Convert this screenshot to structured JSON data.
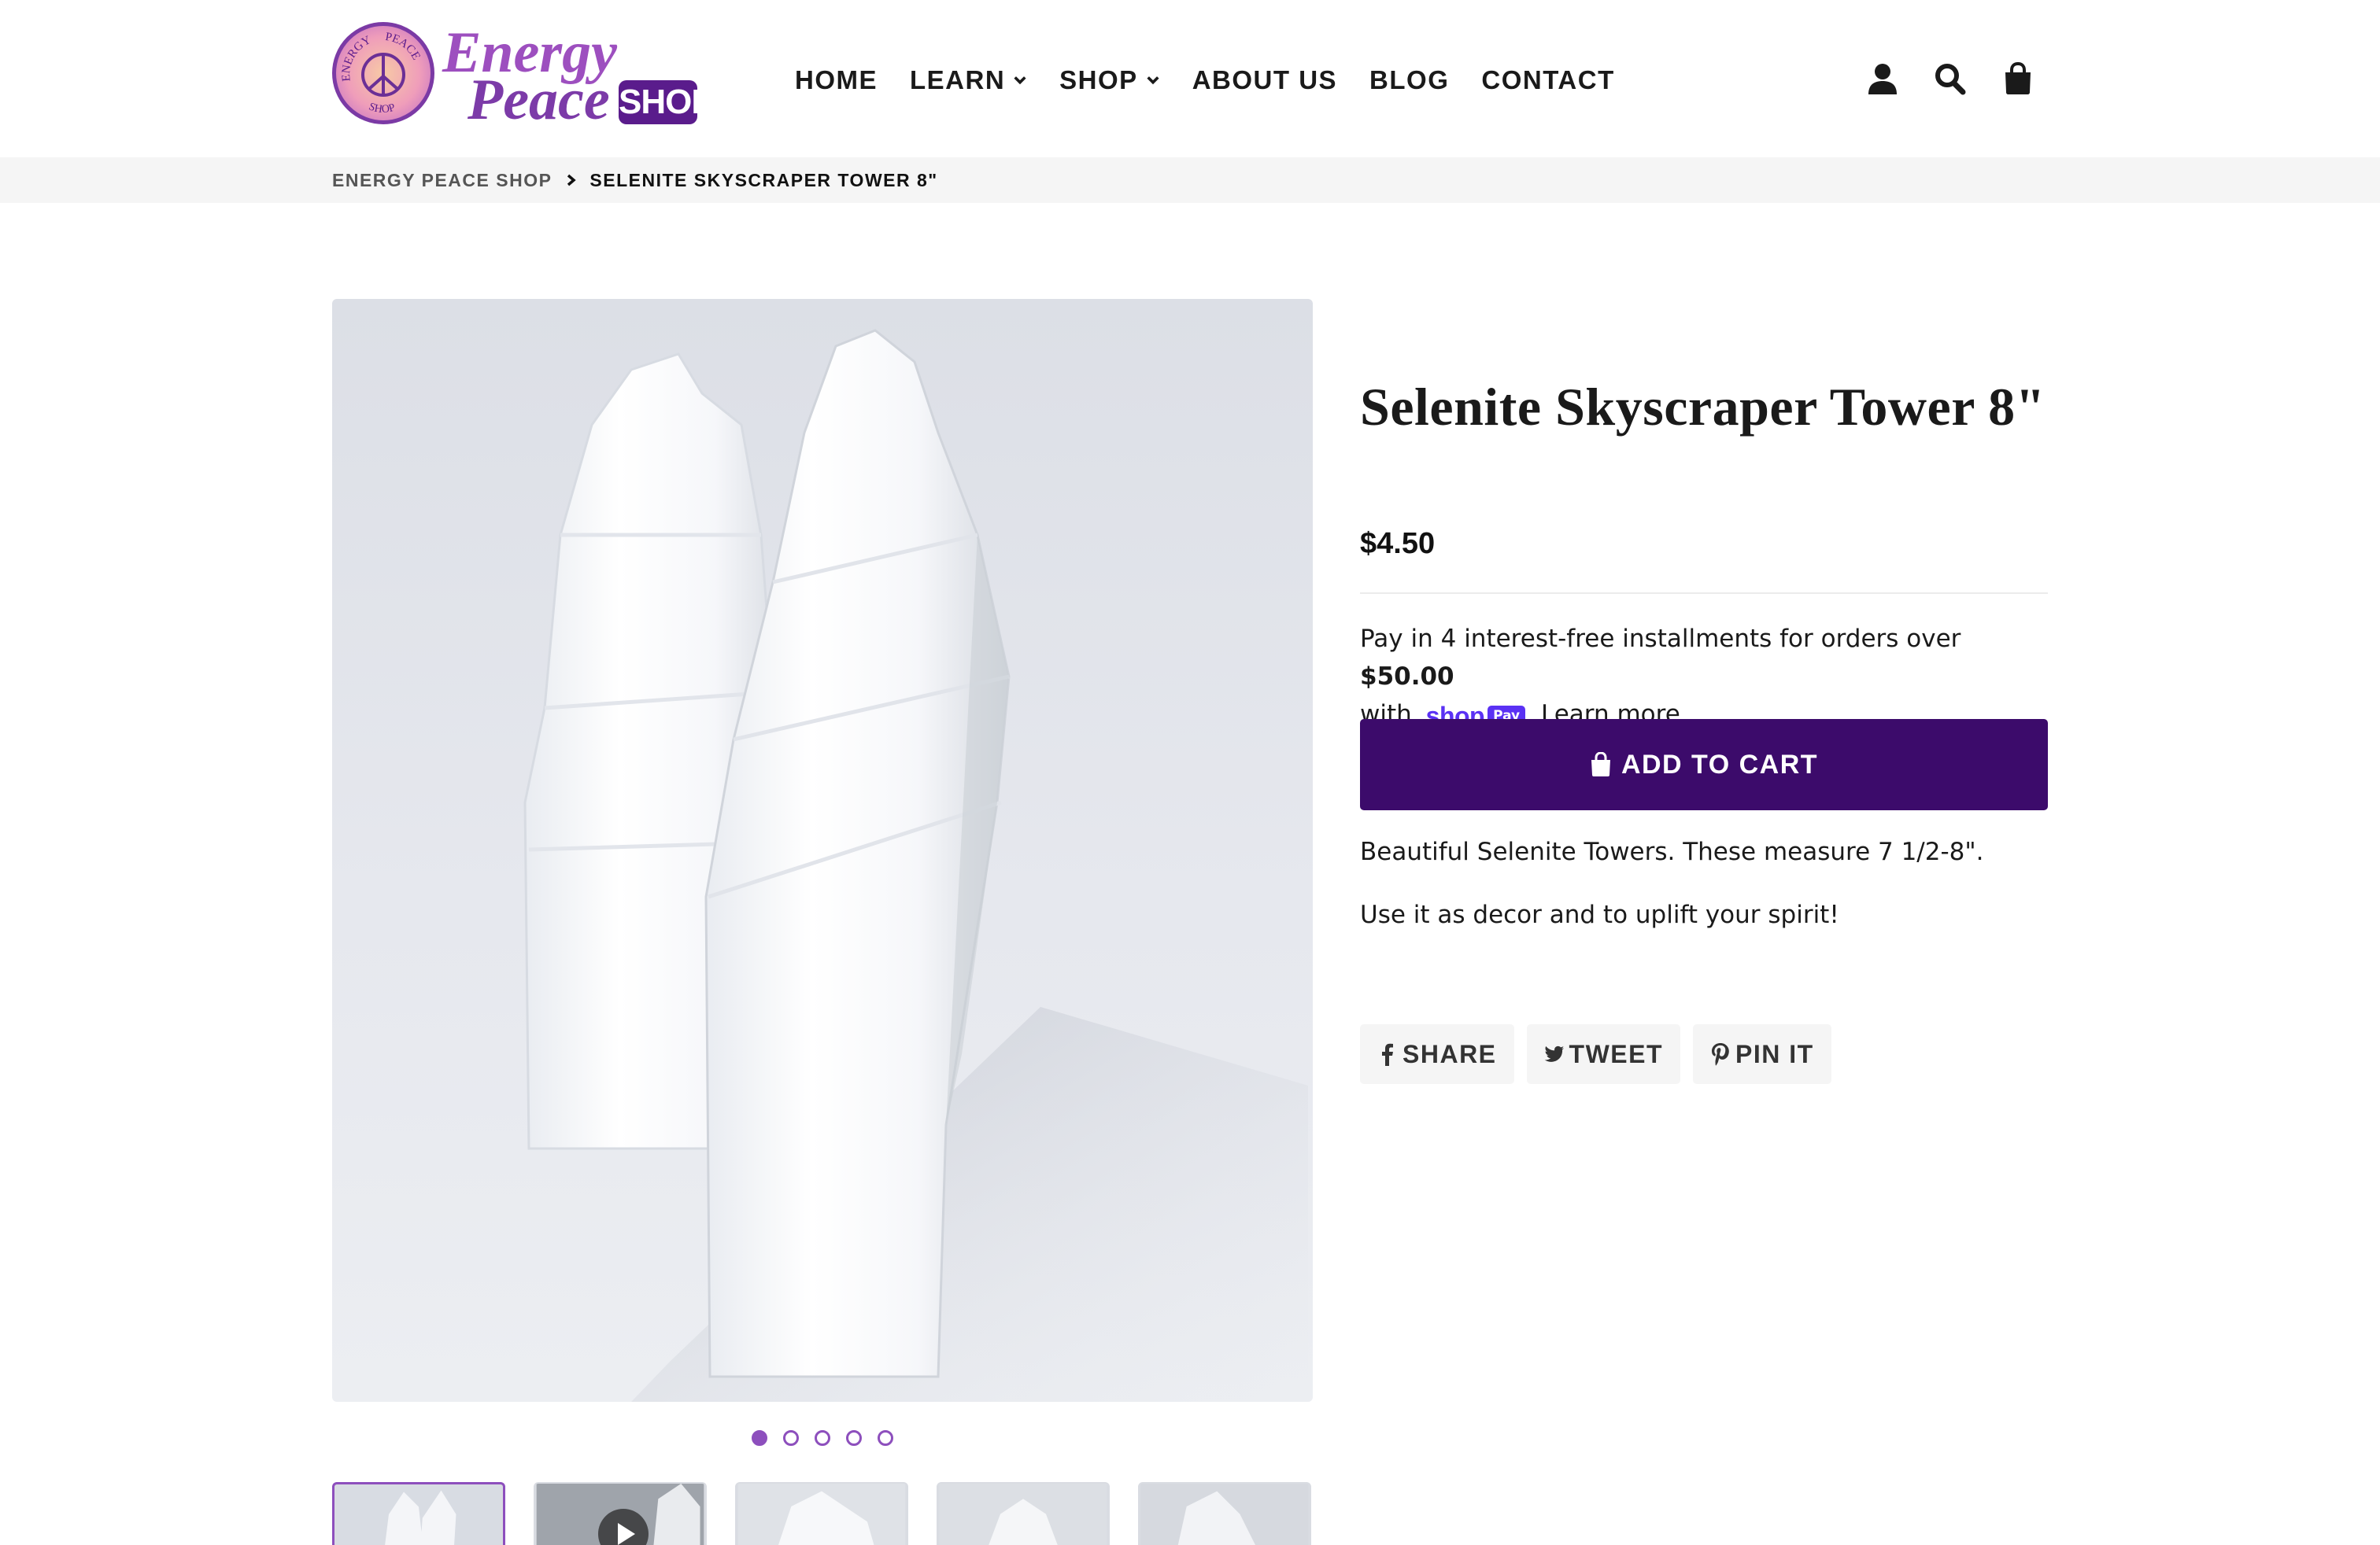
{
  "brand": {
    "name_line1": "Energy",
    "name_line2": "Peace",
    "badge": "SHOP",
    "seal_top_left": "ENERGY",
    "seal_top_right": "PEACE",
    "seal_bottom": "SHOP",
    "primary_color": "#3c0b6b",
    "accent_color": "#8d4fbd"
  },
  "nav": {
    "items": [
      {
        "label": "HOME",
        "has_dropdown": false
      },
      {
        "label": "LEARN",
        "has_dropdown": true
      },
      {
        "label": "SHOP",
        "has_dropdown": true
      },
      {
        "label": "ABOUT US",
        "has_dropdown": false
      },
      {
        "label": "BLOG",
        "has_dropdown": false
      },
      {
        "label": "CONTACT",
        "has_dropdown": false
      }
    ]
  },
  "header_icons": [
    "account-icon",
    "search-icon",
    "cart-icon"
  ],
  "breadcrumb": {
    "home": "ENERGY PEACE SHOP",
    "current": "SELENITE SKYSCRAPER TOWER 8\""
  },
  "gallery": {
    "slide_count": 5,
    "active_slide": 1,
    "thumbnails": [
      {
        "kind": "image",
        "active": true
      },
      {
        "kind": "video",
        "active": false
      },
      {
        "kind": "image",
        "active": false
      },
      {
        "kind": "image",
        "active": false
      },
      {
        "kind": "image",
        "active": false
      }
    ]
  },
  "product": {
    "title": "Selenite Skyscraper Tower 8\"",
    "price": "$4.50",
    "installments_prefix": "Pay in 4 interest-free installments for orders over ",
    "installments_threshold": "$50.00",
    "installments_with": "with",
    "shoppay_text": "shop",
    "shoppay_badge": "Pay",
    "learn_more": "Learn more",
    "add_to_cart": "ADD TO CART",
    "description": [
      "Beautiful Selenite Towers. These measure 7 1/2-8\".",
      "Use it as decor and to uplift your spirit!"
    ]
  },
  "share": {
    "facebook": "SHARE",
    "twitter": "TWEET",
    "pinterest": "PIN IT"
  }
}
